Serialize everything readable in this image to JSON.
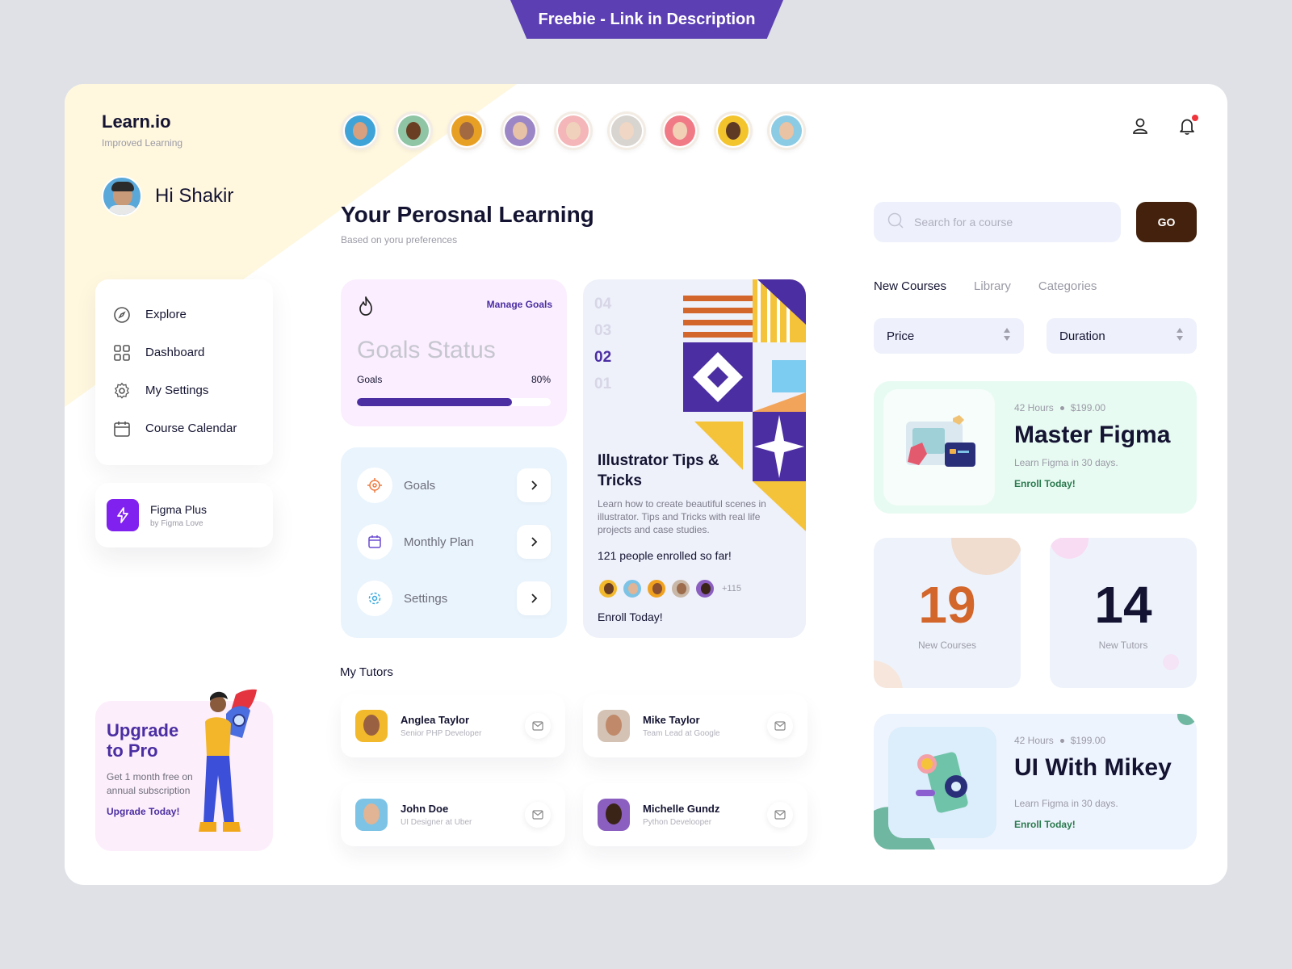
{
  "banner": "Freebie - Link in Description",
  "brand": {
    "name": "Learn.io",
    "tagline": "Improved Learning"
  },
  "user": {
    "greeting": "Hi Shakir"
  },
  "menu": [
    {
      "label": "Explore",
      "icon": "compass-icon"
    },
    {
      "label": "Dashboard",
      "icon": "grid-icon"
    },
    {
      "label": "My Settings",
      "icon": "gear-icon"
    },
    {
      "label": "Course Calendar",
      "icon": "calendar-icon"
    }
  ],
  "plus": {
    "title": "Figma Plus",
    "subtitle": "by Figma Love"
  },
  "upgrade": {
    "title": "Upgrade to Pro",
    "text": "Get 1 month free on annual subscription",
    "link": "Upgrade Today!"
  },
  "page": {
    "title": "Your Perosnal Learning",
    "subtitle": "Based on yoru preferences"
  },
  "goals": {
    "manage": "Manage Goals",
    "title": "Goals Status",
    "label": "Goals",
    "percent_text": "80%",
    "progress": 0.8
  },
  "plans": [
    {
      "label": "Goals",
      "icon": "target-icon",
      "color": "#f07b3f"
    },
    {
      "label": "Monthly Plan",
      "icon": "calendar-icon",
      "color": "#6a4bd1"
    },
    {
      "label": "Settings",
      "icon": "gear-icon",
      "color": "#38a8e0"
    }
  ],
  "featured": {
    "numbers": [
      "04",
      "03",
      "02",
      "01"
    ],
    "active": "02",
    "title": "Illustrator Tips & Tricks",
    "description": "Learn how to create beautiful scenes in illustrator. Tips and Tricks with real life projects and case studies.",
    "enrolled": "121 people enrolled so far!",
    "more": "+115",
    "cta": "Enroll Today!"
  },
  "tutors": {
    "heading": "My Tutors",
    "items": [
      {
        "name": "Anglea Taylor",
        "role": "Senior PHP Developer"
      },
      {
        "name": "Mike Taylor",
        "role": "Team Lead at Google"
      },
      {
        "name": "John Doe",
        "role": "UI Designer at Uber"
      },
      {
        "name": "Michelle Gundz",
        "role": "Python Develooper"
      }
    ]
  },
  "search": {
    "placeholder": "Search for a course",
    "button": "GO"
  },
  "tabs": [
    "New Courses",
    "Library",
    "Categories"
  ],
  "filters": {
    "price": "Price",
    "duration": "Duration"
  },
  "courses": [
    {
      "hours": "42 Hours",
      "price": "$199.00",
      "title": "Master Figma",
      "subtitle": "Learn Figma in 30 days.",
      "cta": "Enroll Today!"
    },
    {
      "hours": "42 Hours",
      "price": "$199.00",
      "title": "UI With Mikey",
      "subtitle": "Learn Figma in 30 days.",
      "cta": "Enroll Today!"
    }
  ],
  "stats": [
    {
      "value": "19",
      "label": "New Courses"
    },
    {
      "value": "14",
      "label": "New Tutors"
    }
  ],
  "colors": {
    "primary": "#4b2ea2",
    "accent_orange": "#d3662b",
    "go_button": "#43210c"
  }
}
